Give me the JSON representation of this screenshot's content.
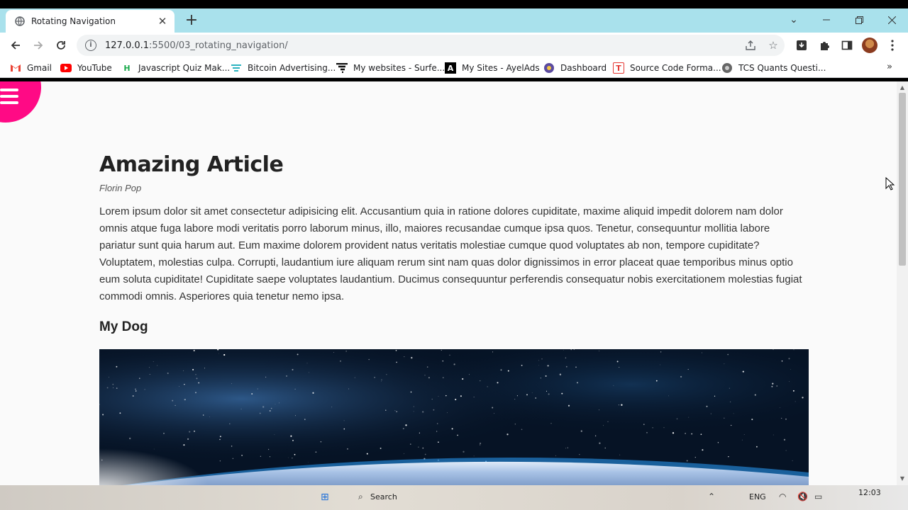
{
  "browser": {
    "tab_title": "Rotating Navigation",
    "url_host": "127.0.0.1",
    "url_rest": ":5500/03_rotating_navigation/"
  },
  "bookmarks": [
    {
      "label": "Gmail",
      "icon": "gmail-icon",
      "color": "#ea4335"
    },
    {
      "label": "YouTube",
      "icon": "youtube-icon",
      "color": "#ff0000"
    },
    {
      "label": "Javascript Quiz Mak...",
      "icon": "h-icon",
      "color": "#1ba94c"
    },
    {
      "label": "Bitcoin Advertising...",
      "icon": "bitcoin-ads-icon",
      "color": "#2bb3c0"
    },
    {
      "label": "My websites - Surfe...",
      "icon": "surfe-icon",
      "color": "#111111"
    },
    {
      "label": "My Sites - AyelAds",
      "icon": "ayelads-icon",
      "color": "#000000"
    },
    {
      "label": "Dashboard",
      "icon": "dashboard-icon",
      "color": "#5b4ba0"
    },
    {
      "label": "Source Code Forma...",
      "icon": "t-icon",
      "color": "#e53935"
    },
    {
      "label": "TCS Quants Questi...",
      "icon": "tcs-icon",
      "color": "#555555"
    }
  ],
  "article": {
    "title": "Amazing Article",
    "author": "Florin Pop",
    "body": "Lorem ipsum dolor sit amet consectetur adipisicing elit. Accusantium quia in ratione dolores cupiditate, maxime aliquid impedit dolorem nam dolor omnis atque fuga labore modi veritatis porro laborum minus, illo, maiores recusandae cumque ipsa quos. Tenetur, consequuntur mollitia labore pariatur sunt quia harum aut. Eum maxime dolorem provident natus veritatis molestiae cumque quod voluptates ab non, tempore cupiditate? Voluptatem, molestias culpa. Corrupti, laudantium iure aliquam rerum sint nam quas dolor dignissimos in error placeat quae temporibus minus optio eum soluta cupiditate! Cupiditate saepe voluptates laudantium. Ducimus consequuntur perferendis consequatur nobis exercitationem molestias fugiat commodi omnis. Asperiores quia tenetur nemo ipsa.",
    "subheading": "My Dog"
  },
  "taskbar": {
    "search_label": "Search",
    "language": "ENG",
    "time": "12:03"
  },
  "colors": {
    "accent": "#ff0a85",
    "tabstrip": "#a9e1ec"
  }
}
